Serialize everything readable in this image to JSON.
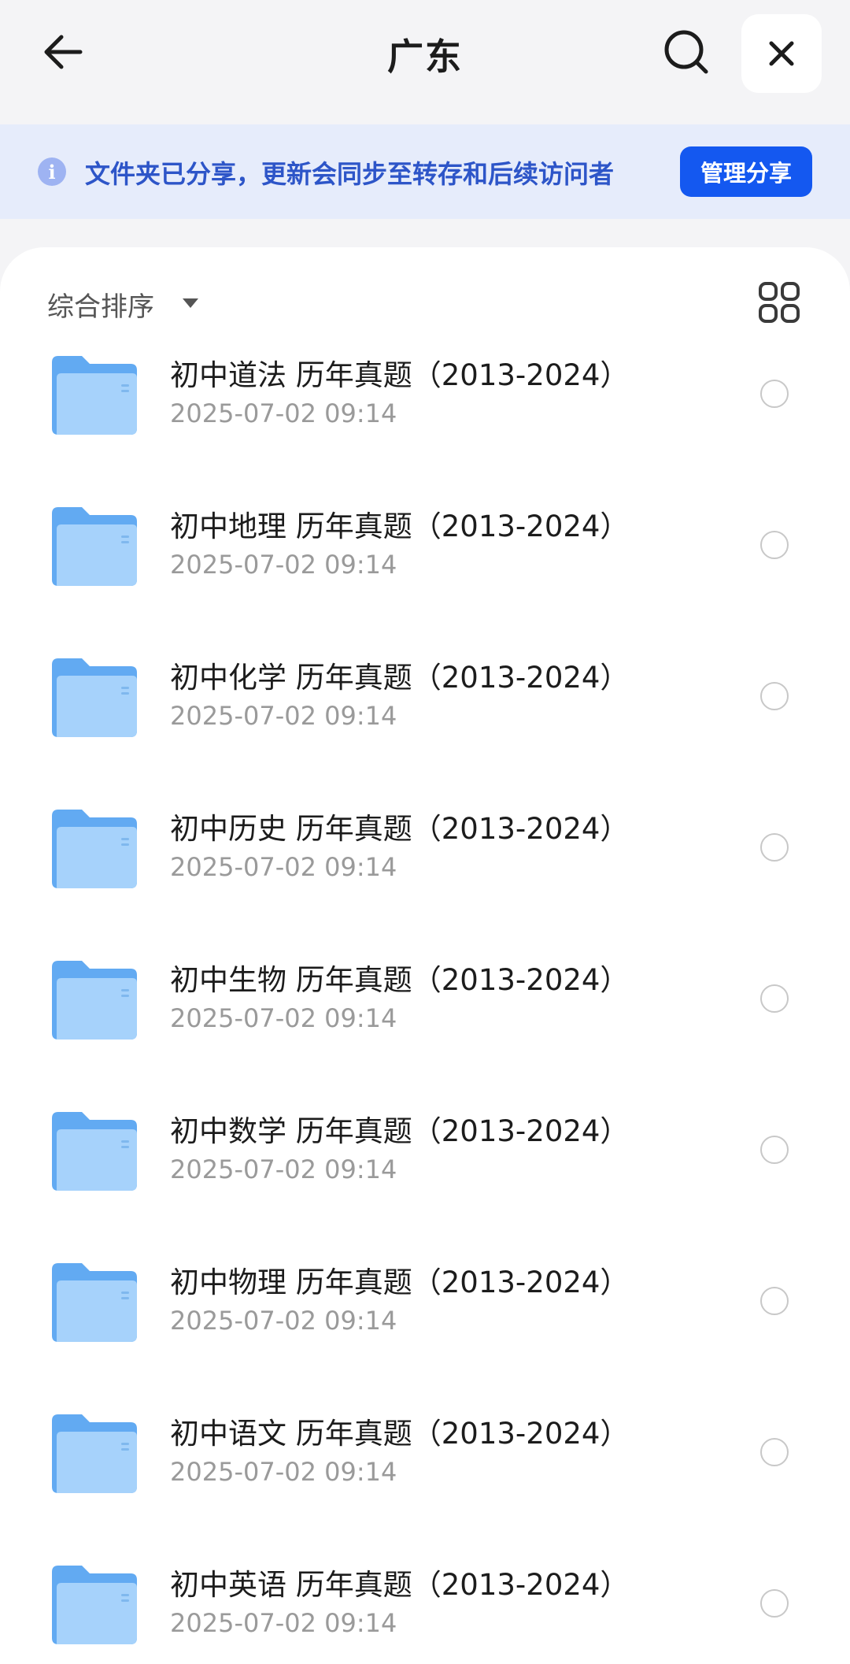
{
  "header": {
    "title": "广东",
    "back_icon": "arrow-left-icon",
    "search_icon": "search-icon",
    "close_icon": "close-icon"
  },
  "banner": {
    "icon": "info-icon",
    "icon_glyph": "i",
    "text": "文件夹已分享，更新会同步至转存和后续访问者",
    "button_label": "管理分享",
    "accent_color": "#1458f0"
  },
  "toolbar": {
    "sort_label": "综合排序",
    "sort_icon": "caret-down-icon",
    "view_icon": "grid-view-icon"
  },
  "files": [
    {
      "name": "初中道法 历年真题（2013-2024）",
      "modified": "2025-07-02 09:14",
      "type": "folder"
    },
    {
      "name": "初中地理 历年真题（2013-2024）",
      "modified": "2025-07-02 09:14",
      "type": "folder"
    },
    {
      "name": "初中化学 历年真题（2013-2024）",
      "modified": "2025-07-02 09:14",
      "type": "folder"
    },
    {
      "name": "初中历史 历年真题（2013-2024）",
      "modified": "2025-07-02 09:14",
      "type": "folder"
    },
    {
      "name": "初中生物 历年真题（2013-2024）",
      "modified": "2025-07-02 09:14",
      "type": "folder"
    },
    {
      "name": "初中数学 历年真题（2013-2024）",
      "modified": "2025-07-02 09:14",
      "type": "folder"
    },
    {
      "name": "初中物理 历年真题（2013-2024）",
      "modified": "2025-07-02 09:14",
      "type": "folder"
    },
    {
      "name": "初中语文 历年真题（2013-2024）",
      "modified": "2025-07-02 09:14",
      "type": "folder"
    },
    {
      "name": "初中英语 历年真题（2013-2024）",
      "modified": "2025-07-02 09:14",
      "type": "folder"
    }
  ]
}
